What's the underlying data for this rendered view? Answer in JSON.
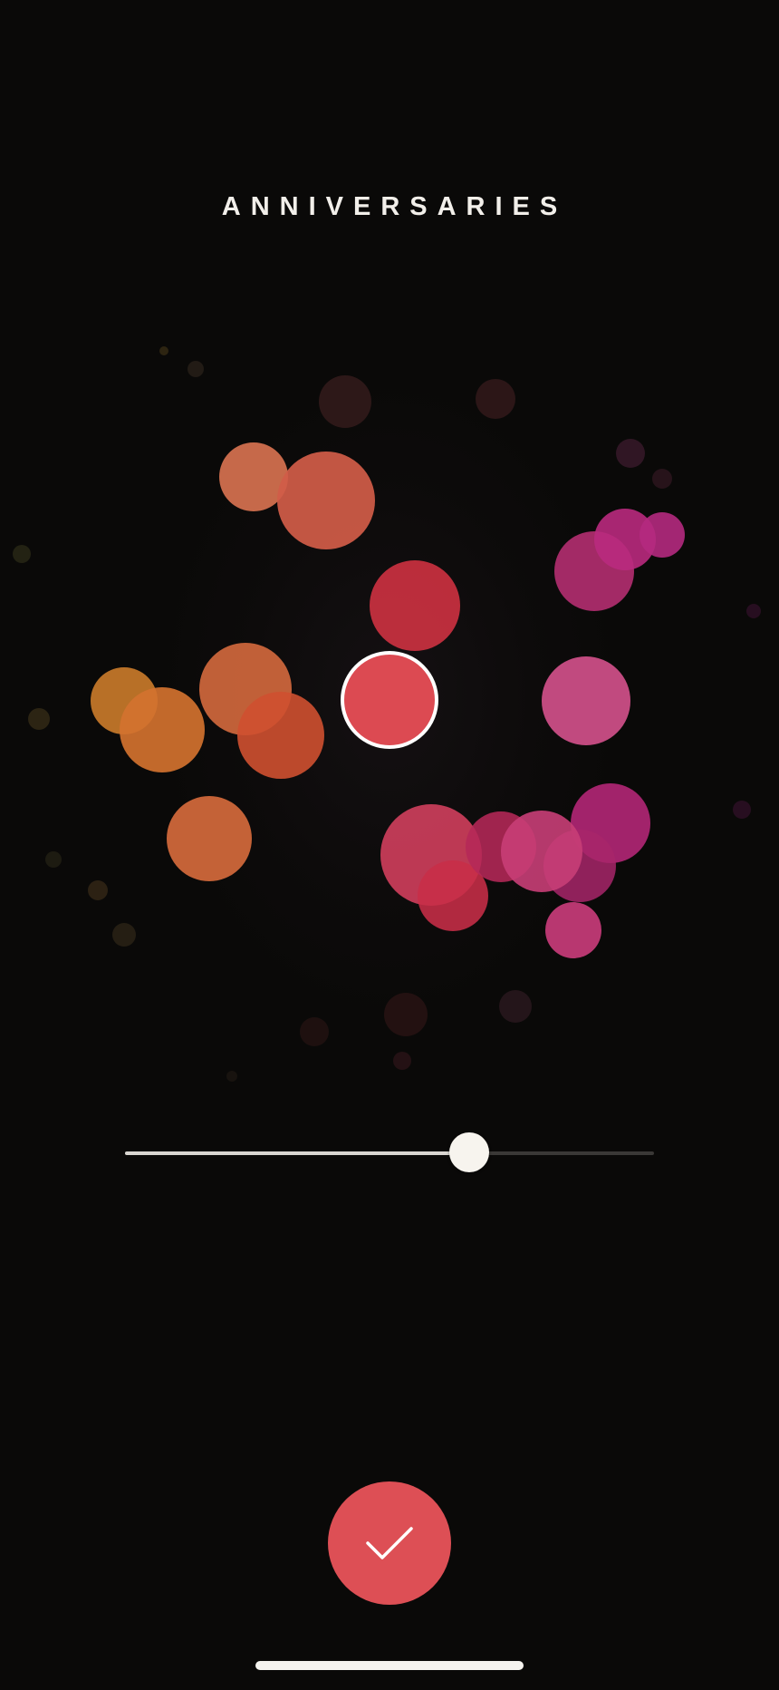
{
  "screen": {
    "title": "ANNIVERSARIES"
  },
  "palette": {
    "selected_color": "#dc4a52",
    "selection_ring_color": "#ffffff"
  },
  "slider": {
    "value_fraction": 0.65,
    "fill_color": "#d9d6d1",
    "track_color": "#3a3836",
    "thumb_color": "#f7f4ee"
  },
  "confirm": {
    "icon": "checkmark-icon",
    "color": "#dd4f55"
  },
  "system": {
    "home_indicator": "home-indicator"
  }
}
